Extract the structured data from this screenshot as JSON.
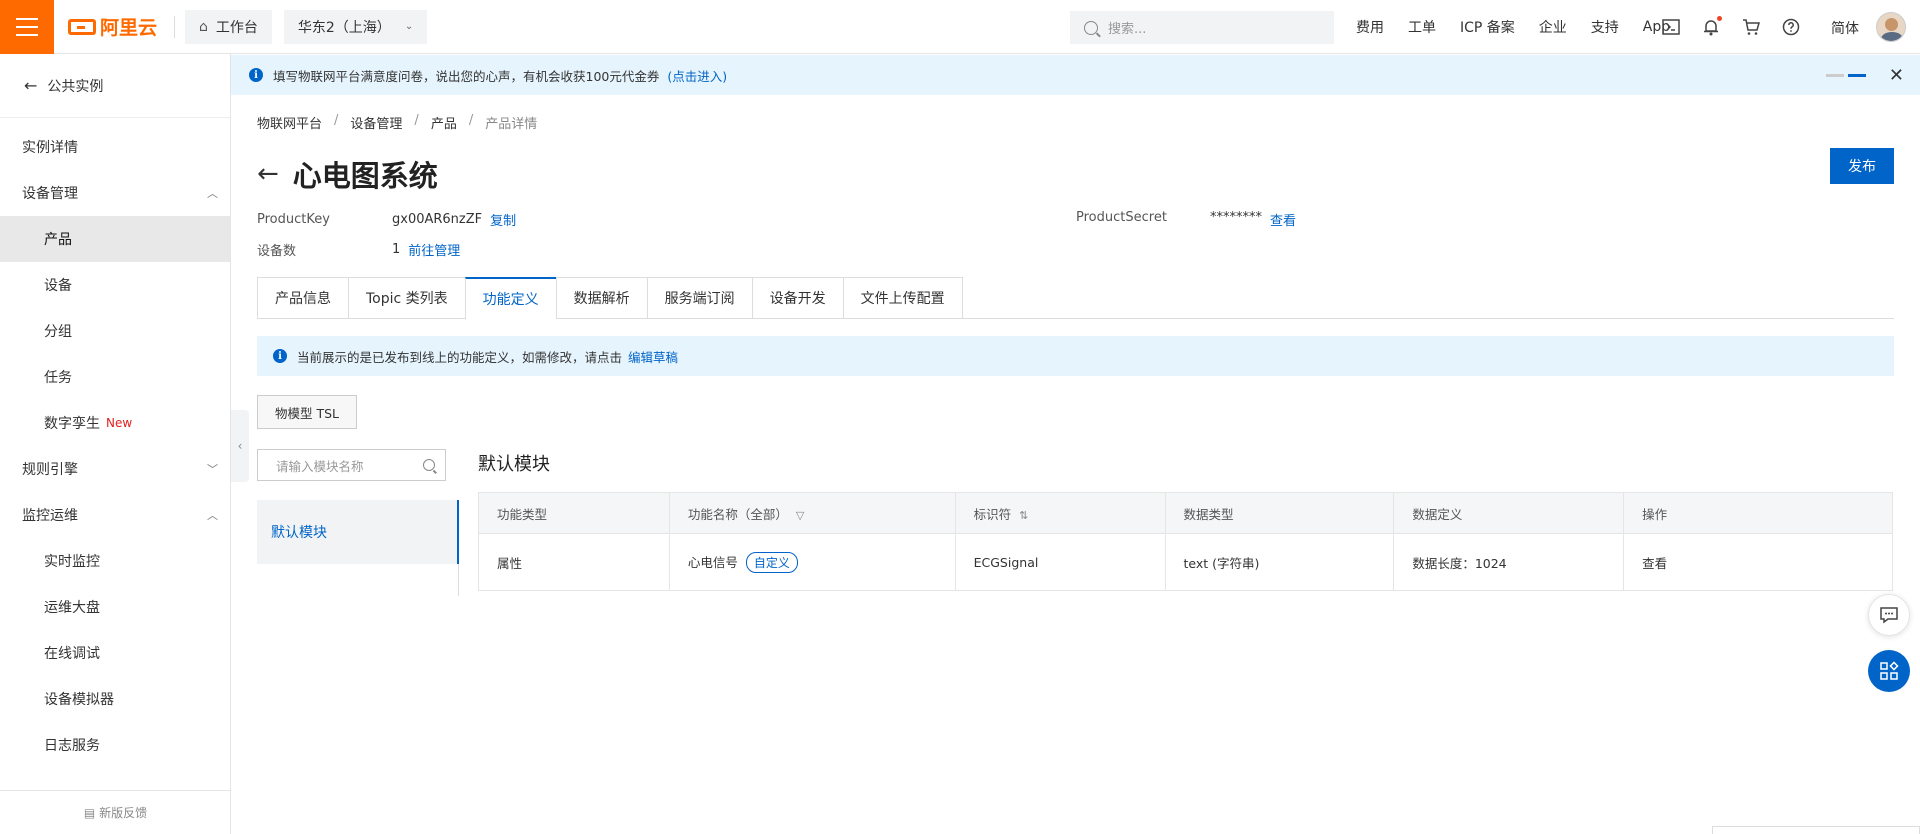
{
  "topbar": {
    "brand": "阿里云",
    "workspace": "工作台",
    "region": "华东2（上海）",
    "search_placeholder": "搜索...",
    "links": [
      "费用",
      "工单",
      "ICP 备案",
      "企业",
      "支持",
      "App"
    ],
    "icons": [
      "terminal-icon",
      "bell-icon",
      "cart-icon",
      "help-icon"
    ],
    "language": "简体"
  },
  "sidebar": {
    "back_label": "公共实例",
    "items": [
      {
        "label": "实例详情",
        "level": "group"
      },
      {
        "label": "设备管理",
        "level": "group",
        "caret": "up"
      },
      {
        "label": "产品",
        "level": "sub",
        "active": true
      },
      {
        "label": "设备",
        "level": "sub"
      },
      {
        "label": "分组",
        "level": "sub"
      },
      {
        "label": "任务",
        "level": "sub"
      },
      {
        "label": "数字孪生",
        "level": "sub",
        "badge": "New"
      },
      {
        "label": "规则引擎",
        "level": "group",
        "caret": "down"
      },
      {
        "label": "监控运维",
        "level": "group",
        "caret": "up"
      },
      {
        "label": "实时监控",
        "level": "sub"
      },
      {
        "label": "运维大盘",
        "level": "sub"
      },
      {
        "label": "在线调试",
        "level": "sub"
      },
      {
        "label": "设备模拟器",
        "level": "sub"
      },
      {
        "label": "日志服务",
        "level": "sub"
      }
    ],
    "feedback": "新版反馈"
  },
  "notice": {
    "text": "填写物联网平台满意度问卷，说出您的心声，有机会收获100元代金券",
    "link": "(点击进入)"
  },
  "breadcrumb": [
    "物联网平台",
    "设备管理",
    "产品",
    "产品详情"
  ],
  "product": {
    "title": "心电图系统",
    "publish": "发布",
    "product_key_label": "ProductKey",
    "product_key": "gx00AR6nzZF",
    "copy": "复制",
    "device_count_label": "设备数",
    "device_count": "1",
    "manage": "前往管理",
    "secret_label": "ProductSecret",
    "secret": "********",
    "view": "查看"
  },
  "tabs": [
    "产品信息",
    "Topic 类列表",
    "功能定义",
    "数据解析",
    "服务端订阅",
    "设备开发",
    "文件上传配置"
  ],
  "active_tab": "功能定义",
  "alert": {
    "text": "当前展示的是已发布到线上的功能定义，如需修改，请点击",
    "link": "编辑草稿"
  },
  "tsl_button": "物模型 TSL",
  "module_search_placeholder": "请输入模块名称",
  "modules": [
    "默认模块"
  ],
  "module_heading": "默认模块",
  "table": {
    "headers": [
      "功能类型",
      "功能名称（全部）",
      "标识符",
      "数据类型",
      "数据定义",
      "操作"
    ],
    "rows": [
      {
        "type": "属性",
        "name": "心电信号",
        "tag": "自定义",
        "identifier": "ECGSignal",
        "data_type": "text (字符串)",
        "definition": "数据长度：1024",
        "action": "查看"
      }
    ]
  },
  "colors": {
    "brand": "#ff6a00",
    "primary": "#0064c8",
    "notice_bg": "#e6f4fd"
  }
}
